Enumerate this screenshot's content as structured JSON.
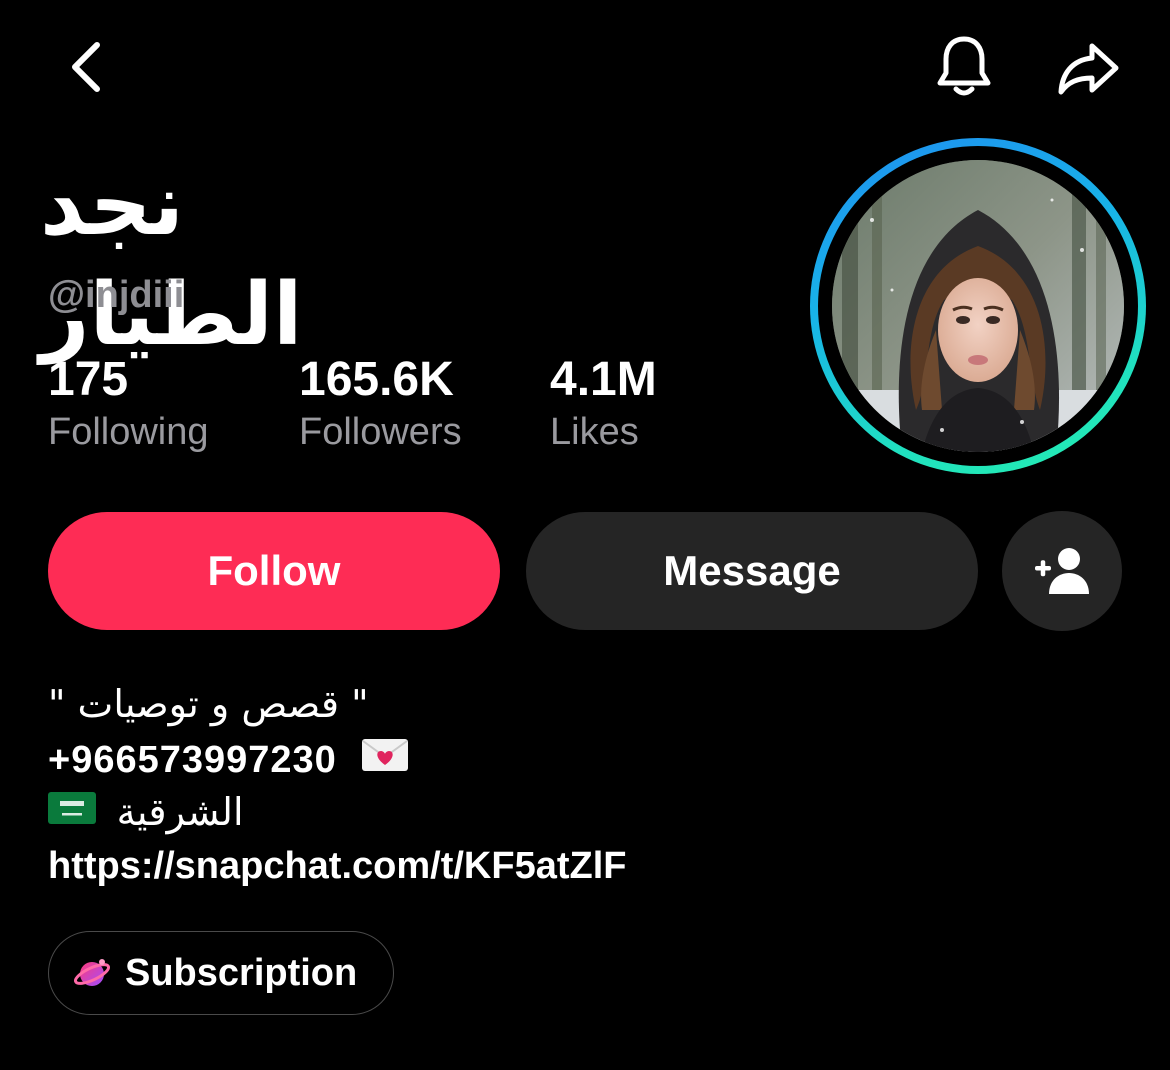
{
  "header": {
    "back_icon": "chevron-left-icon",
    "bell_icon": "bell-icon",
    "share_icon": "share-arrow-icon"
  },
  "profile": {
    "display_name": "نجد الطيار",
    "username": "@injdiii"
  },
  "stats": [
    {
      "value": "175",
      "label": "Following"
    },
    {
      "value": "165.6K",
      "label": "Followers"
    },
    {
      "value": "4.1M",
      "label": "Likes"
    }
  ],
  "actions": {
    "follow_label": "Follow",
    "message_label": "Message",
    "add_friend_icon": "add-user-icon"
  },
  "bio": {
    "line1": "\" قصص و توصيات \"",
    "phone": "+966573997230",
    "region": "الشرقية",
    "link": "https://snapchat.com/t/KF5atZlF"
  },
  "subscription": {
    "label": "Subscription"
  },
  "colors": {
    "background": "#000000",
    "follow": "#fe2c55",
    "secondary_button": "#252525",
    "muted_text": "#8e8e93",
    "ring_start": "#1f8ef0",
    "ring_end": "#25f0b0"
  }
}
